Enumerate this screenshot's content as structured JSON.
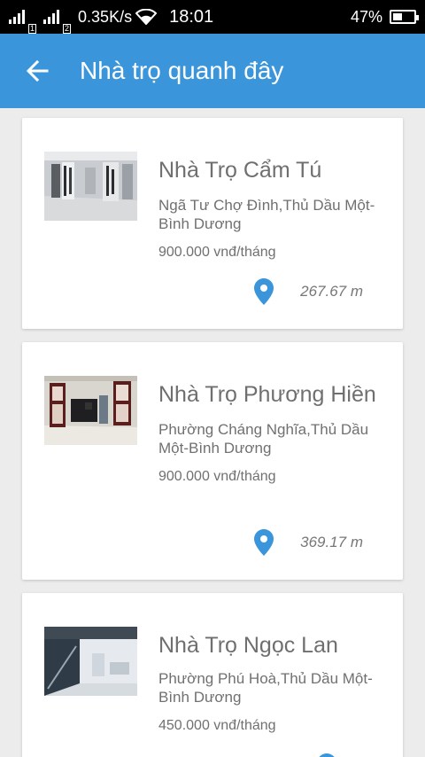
{
  "status_bar": {
    "speed": "0.35K/s",
    "time": "18:01",
    "battery": "47%",
    "battery_level": 0.47,
    "sim1": "1",
    "sim2": "2"
  },
  "app_bar": {
    "title": "Nhà trọ quanh đây",
    "color": "#3a95db"
  },
  "listings": [
    {
      "name": "Nhà Trọ Cẩm Tú",
      "address": "Ngã Tư Chợ Đình,Thủ Dầu Một-Bình Dương",
      "price": "900.000 vnđ/tháng",
      "distance": "267.67 m"
    },
    {
      "name": "Nhà Trọ Phương Hiền",
      "address": "Phường Cháng Nghĩa,Thủ Dầu Một-Bình Dương",
      "price": "900.000 vnđ/tháng",
      "distance": "369.17 m"
    },
    {
      "name": "Nhà Trọ Ngọc Lan",
      "address": "Phường Phú Hoà,Thủ Dầu Một-Bình Dương",
      "price": "450.000 vnđ/tháng",
      "distance": ""
    }
  ],
  "icons": {
    "back": "arrow-left-icon",
    "location": "location-pin-icon",
    "wifi": "wifi-icon",
    "signal": "signal-icon",
    "battery": "battery-icon"
  },
  "accent_color": "#3a95db"
}
